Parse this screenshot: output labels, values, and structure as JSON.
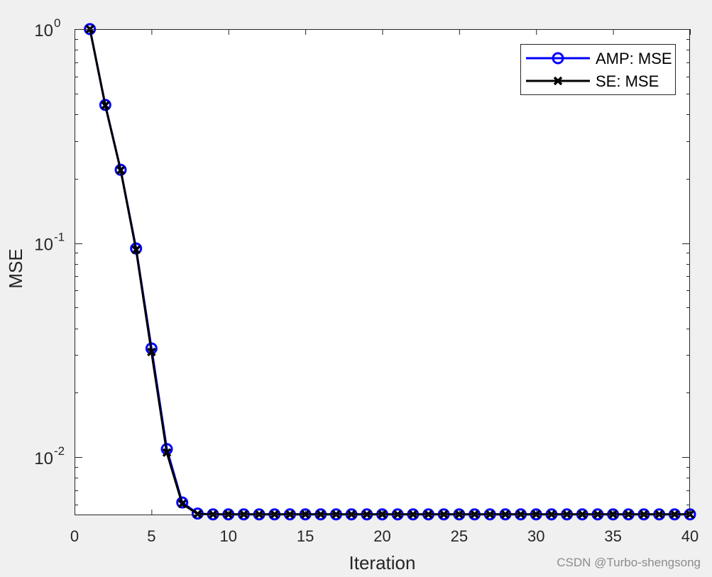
{
  "chart_data": {
    "type": "line",
    "title": "",
    "xlabel": "Iteration",
    "ylabel": "MSE",
    "xlim": [
      0,
      40
    ],
    "ylim": [
      0.00535,
      1
    ],
    "yscale": "log",
    "grid": false,
    "legend_position": "top-right",
    "x_ticks": [
      0,
      5,
      10,
      15,
      20,
      25,
      30,
      35,
      40
    ],
    "y_ticks": [
      {
        "value": 1,
        "base": "10",
        "exp": "0"
      },
      {
        "value": 0.1,
        "base": "10",
        "exp": "-1"
      },
      {
        "value": 0.01,
        "base": "10",
        "exp": "-2"
      }
    ],
    "x": [
      1,
      2,
      3,
      4,
      5,
      6,
      7,
      8,
      9,
      10,
      11,
      12,
      13,
      14,
      15,
      16,
      17,
      18,
      19,
      20,
      21,
      22,
      23,
      24,
      25,
      26,
      27,
      28,
      29,
      30,
      31,
      32,
      33,
      34,
      35,
      36,
      37,
      38,
      39,
      40
    ],
    "series": [
      {
        "name": "AMP: MSE",
        "color": "#0000ff",
        "marker": "circle",
        "values": [
          1.0,
          0.442,
          0.22,
          0.0944,
          0.0322,
          0.0109,
          0.00614,
          0.00545,
          0.0054,
          0.0054,
          0.0054,
          0.0054,
          0.0054,
          0.0054,
          0.0054,
          0.0054,
          0.0054,
          0.0054,
          0.0054,
          0.0054,
          0.0054,
          0.0054,
          0.0054,
          0.0054,
          0.0054,
          0.0054,
          0.0054,
          0.0054,
          0.0054,
          0.0054,
          0.0054,
          0.0054,
          0.0054,
          0.0054,
          0.0054,
          0.0054,
          0.0054,
          0.0054,
          0.0054,
          0.0054
        ]
      },
      {
        "name": "SE: MSE",
        "color": "#000000",
        "marker": "x",
        "values": [
          1.0,
          0.44,
          0.219,
          0.093,
          0.031,
          0.0105,
          0.00605,
          0.00542,
          0.0054,
          0.0054,
          0.0054,
          0.0054,
          0.0054,
          0.0054,
          0.0054,
          0.0054,
          0.0054,
          0.0054,
          0.0054,
          0.0054,
          0.0054,
          0.0054,
          0.0054,
          0.0054,
          0.0054,
          0.0054,
          0.0054,
          0.0054,
          0.0054,
          0.0054,
          0.0054,
          0.0054,
          0.0054,
          0.0054,
          0.0054,
          0.0054,
          0.0054,
          0.0054,
          0.0054,
          0.0054
        ]
      }
    ]
  },
  "watermark": "CSDN @Turbo-shengsong"
}
